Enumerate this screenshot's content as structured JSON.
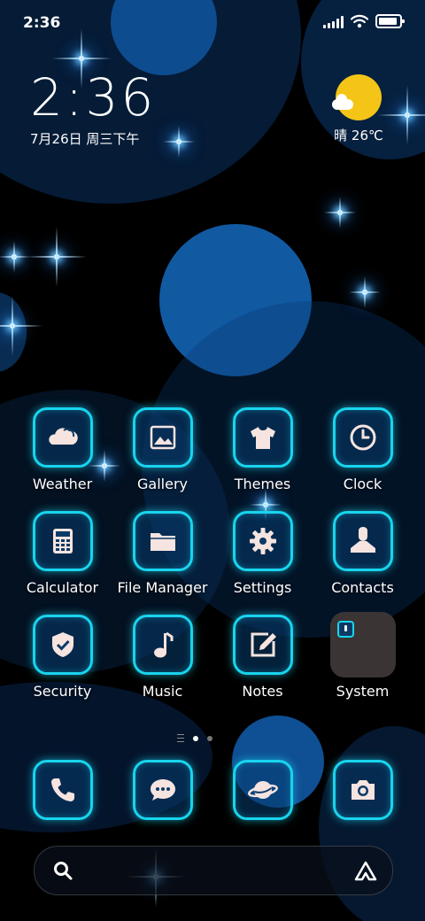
{
  "status_bar": {
    "time": "2:36",
    "icons": [
      "signal-icon",
      "wifi-icon",
      "battery-icon"
    ]
  },
  "clock_widget": {
    "time": "2:36",
    "date": "7月26日 周三下午"
  },
  "weather_widget": {
    "icon": "sunny-cloud-icon",
    "text": "晴 26℃"
  },
  "apps": [
    {
      "label": "Weather",
      "icon": "weather-icon"
    },
    {
      "label": "Gallery",
      "icon": "gallery-icon"
    },
    {
      "label": "Themes",
      "icon": "tshirt-icon"
    },
    {
      "label": "Clock",
      "icon": "clock-icon"
    },
    {
      "label": "Calculator",
      "icon": "calculator-icon"
    },
    {
      "label": "File Manager",
      "icon": "folder-icon"
    },
    {
      "label": "Settings",
      "icon": "gear-icon"
    },
    {
      "label": "Contacts",
      "icon": "person-icon"
    },
    {
      "label": "Security",
      "icon": "shield-icon"
    },
    {
      "label": "Music",
      "icon": "music-note-icon"
    },
    {
      "label": "Notes",
      "icon": "edit-icon"
    },
    {
      "label": "System",
      "icon": "folder-icon"
    }
  ],
  "page_indicator": {
    "pages": 2,
    "active": 1
  },
  "dock": [
    {
      "icon": "phone-icon"
    },
    {
      "icon": "message-icon"
    },
    {
      "icon": "planet-icon"
    },
    {
      "icon": "camera-icon"
    }
  ],
  "search_bar": {
    "left_icon": "search-icon",
    "right_icon": "assistant-icon"
  },
  "colors": {
    "accent": "#19d4ee",
    "icon_glyph": "#f5e4e0",
    "background": "#000000",
    "sun": "#f4c516"
  }
}
